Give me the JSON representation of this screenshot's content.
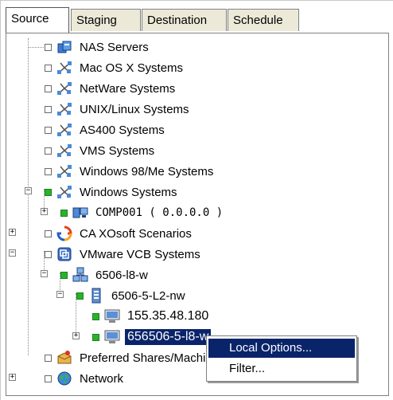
{
  "tabs": [
    {
      "label": "Source",
      "active": true
    },
    {
      "label": "Staging",
      "active": false
    },
    {
      "label": "Destination",
      "active": false
    },
    {
      "label": "Schedule",
      "active": false
    }
  ],
  "tree": [
    {
      "label": "NAS Servers",
      "icon": "nas-server-icon",
      "checked": false
    },
    {
      "label": "Mac OS X Systems",
      "icon": "network-systems-icon",
      "checked": false
    },
    {
      "label": "NetWare Systems",
      "icon": "network-systems-icon",
      "checked": false
    },
    {
      "label": "UNIX/Linux Systems",
      "icon": "network-systems-icon",
      "checked": false
    },
    {
      "label": "AS400 Systems",
      "icon": "network-systems-icon",
      "checked": false
    },
    {
      "label": "VMS Systems",
      "icon": "network-systems-icon",
      "checked": false
    },
    {
      "label": "Windows 98/Me Systems",
      "icon": "network-systems-icon",
      "checked": false
    },
    {
      "label": "Windows Systems",
      "icon": "network-systems-icon",
      "checked": true,
      "expanded": true
    },
    {
      "label": "COMP001 ( 0.0.0.0 )",
      "icon": "computer-icon",
      "checked": true,
      "expanded": false
    },
    {
      "label": "CA XOsoft Scenarios",
      "icon": "refresh-scenario-icon",
      "checked": false,
      "expanded": false
    },
    {
      "label": "VMware VCB Systems",
      "icon": "vmware-icon",
      "checked": false,
      "expanded": true
    },
    {
      "label": "6506-l8-w",
      "icon": "server-group-icon",
      "checked": true,
      "expanded": true
    },
    {
      "label": "6506-5-L2-nw",
      "icon": "server-icon",
      "checked": true,
      "expanded": true
    },
    {
      "label": "155.35.48.180",
      "icon": "monitor-icon",
      "checked": true
    },
    {
      "label": "656506-5-l8-w",
      "icon": "monitor-icon",
      "checked": true,
      "selected": true,
      "expanded": false
    },
    {
      "label": "Preferred Shares/Machines",
      "icon": "shares-box-icon",
      "checked": false
    },
    {
      "label": "Network",
      "icon": "network-globe-icon",
      "checked": false,
      "expanded": false
    }
  ],
  "context_menu": {
    "items": [
      {
        "label": "Local Options...",
        "highlighted": true
      },
      {
        "label": "Filter...",
        "highlighted": false
      }
    ]
  },
  "colors": {
    "selection": "#0a246a",
    "check_green": "#27b32a"
  }
}
